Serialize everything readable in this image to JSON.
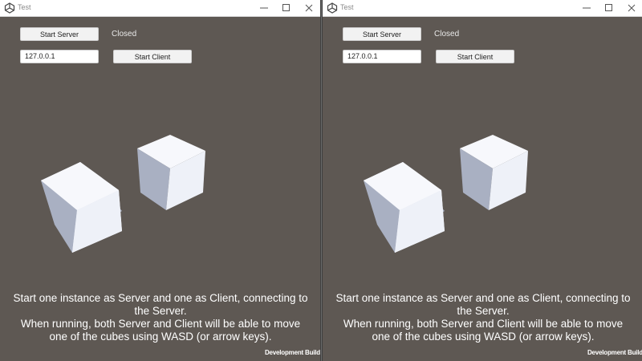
{
  "windows": [
    {
      "title": "Test",
      "buttons": {
        "start_server": "Start Server",
        "start_client": "Start Client"
      },
      "status": "Closed",
      "ip_address": "127.0.0.1",
      "instructions": [
        "Start one instance as Server and one as Client, connecting to",
        "the Server.",
        "When running, both Server and Client will be able to move",
        "one of the cubes using WASD (or arrow keys)."
      ],
      "footer": "Development Build"
    },
    {
      "title": "Test",
      "buttons": {
        "start_server": "Start Server",
        "start_client": "Start Client"
      },
      "status": "Closed",
      "ip_address": "127.0.0.1",
      "instructions": [
        "Start one instance as Server and one as Client, connecting to",
        "the Server.",
        "When running, both Server and Client will be able to move",
        "one of the cubes using WASD (or arrow keys)."
      ],
      "footer": "Development Build"
    }
  ],
  "colors": {
    "scene_background": "#5e5853",
    "cube_light": "#f3f5fb",
    "cube_shade": "#a9b0c2",
    "text": "#ffffff"
  }
}
